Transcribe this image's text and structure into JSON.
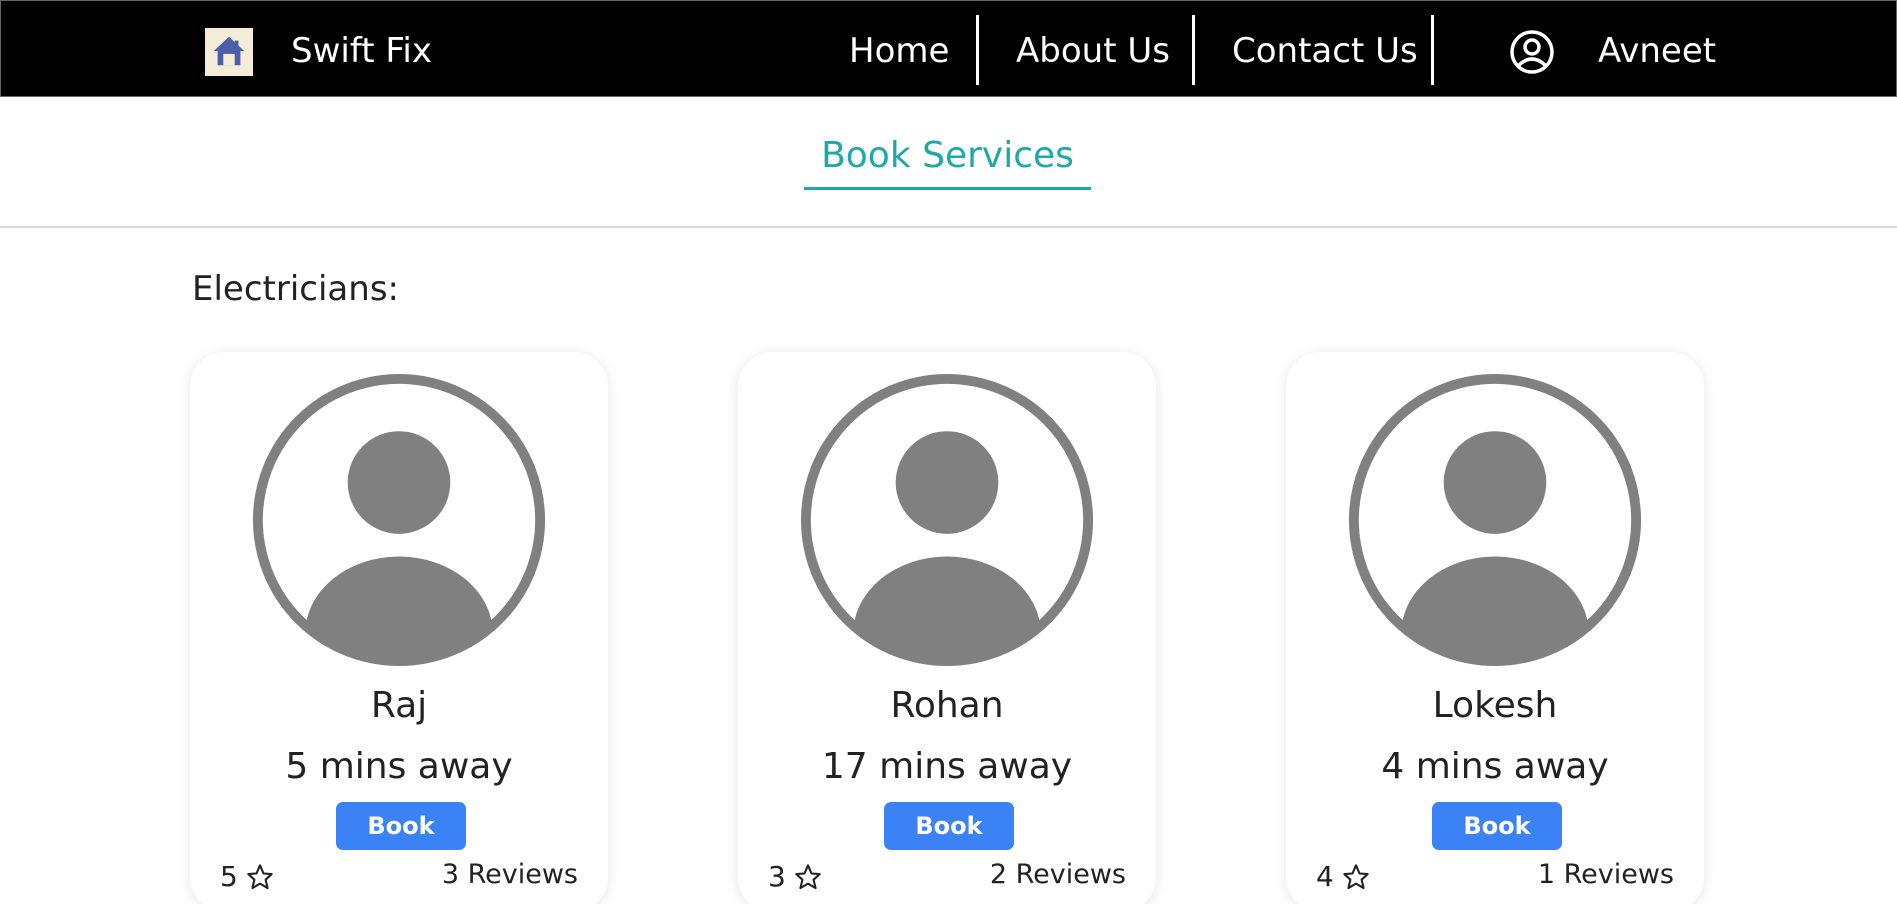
{
  "navbar": {
    "brand_name": "Swift Fix",
    "brand_icon": "house-logo-icon",
    "links": [
      "Home",
      "About Us",
      "Contact Us"
    ],
    "user_icon": "user-circle-icon",
    "user_name": "Avneet"
  },
  "tab": {
    "label": "Book Services",
    "color": "#1fa8a8"
  },
  "section": {
    "title": "Electricians:"
  },
  "cards": [
    {
      "name": "Raj",
      "distance": "5 mins away",
      "button": "Book",
      "rating": "5",
      "reviews": "3 Reviews"
    },
    {
      "name": "Rohan",
      "distance": "17 mins away",
      "button": "Book",
      "rating": "3",
      "reviews": "2 Reviews"
    },
    {
      "name": "Lokesh",
      "distance": "4 mins away",
      "button": "Book",
      "rating": "4",
      "reviews": "1 Reviews"
    }
  ],
  "colors": {
    "nav_bg": "#000000",
    "button": "#3b82f6",
    "avatar": "#808080"
  }
}
